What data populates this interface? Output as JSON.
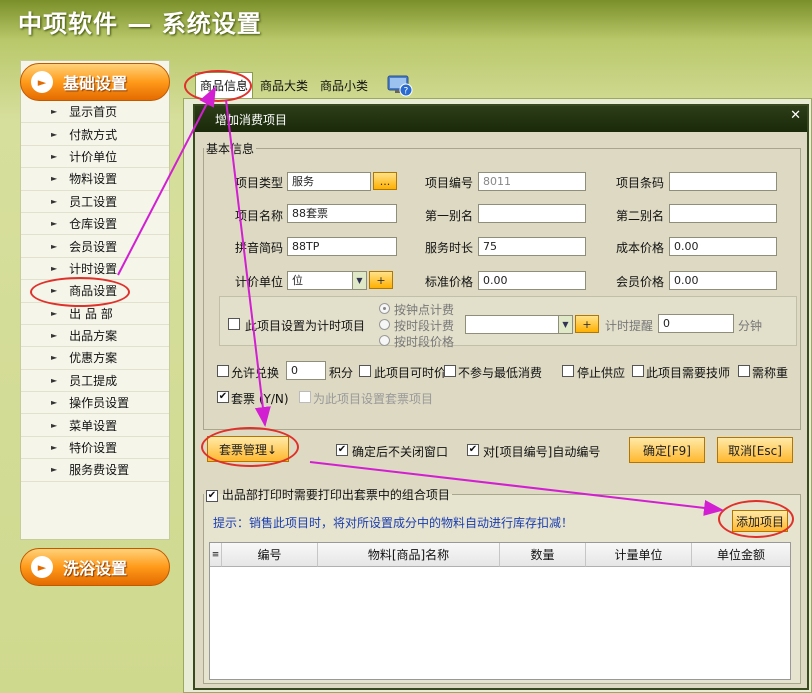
{
  "app_title": "中项软件 — 系统设置",
  "sidebar": {
    "section1": "基础设置",
    "section2": "洗浴设置",
    "items": [
      {
        "label": "显示首页"
      },
      {
        "label": "付款方式"
      },
      {
        "label": "计价单位"
      },
      {
        "label": "物料设置"
      },
      {
        "label": "员工设置"
      },
      {
        "label": "仓库设置"
      },
      {
        "label": "会员设置"
      },
      {
        "label": "计时设置"
      },
      {
        "label": "商品设置"
      },
      {
        "label": "出 品 部"
      },
      {
        "label": "出品方案"
      },
      {
        "label": "优惠方案"
      },
      {
        "label": "员工提成"
      },
      {
        "label": "操作员设置"
      },
      {
        "label": "菜单设置"
      },
      {
        "label": "特价设置"
      },
      {
        "label": "服务费设置"
      }
    ]
  },
  "tabs": [
    "商品信息",
    "商品大类",
    "商品小类"
  ],
  "dialog": {
    "title": "增加消费项目",
    "basic_legend": "基本信息",
    "labels": {
      "type": "项目类型",
      "code": "项目编号",
      "barcode": "项目条码",
      "name": "项目名称",
      "alias1": "第一别名",
      "alias2": "第二别名",
      "pinyin": "拼音简码",
      "duration": "服务时长",
      "cost": "成本价格",
      "unit": "计价单位",
      "std_price": "标准价格",
      "member_price": "会员价格"
    },
    "values": {
      "type": "服务",
      "code": "8011",
      "barcode": "",
      "name": "88套票",
      "alias1": "",
      "alias2": "",
      "pinyin": "88TP",
      "duration": "75",
      "cost": "0.00",
      "unit": "位",
      "std_price": "0.00",
      "member_price": "0.00"
    },
    "ellipsis": "...",
    "plus": "+",
    "timing": {
      "checkbox_label": "此项目设置为计时项目",
      "radio1": "按钟点计费",
      "radio2": "按时段计费",
      "radio3": "按时段价格",
      "remind_label": "计时提醒",
      "remind_value": "0",
      "minutes": "分钟"
    },
    "options": {
      "allow_exchange": "允许兑换",
      "exchange_value": "0",
      "points": "积分",
      "time_price": "此项目可时价",
      "no_min": "不参与最低消费",
      "stop_supply": "停止供应",
      "need_tech": "此项目需要技师",
      "need_weigh": "需称重",
      "package": "套票 (Y/N)",
      "package_set": "为此项目设置套票项目"
    },
    "package_mgmt": "套票管理↓",
    "keep_open": "确定后不关闭窗口",
    "auto_number": "对[项目编号]自动编号",
    "ok": "确定[F9]",
    "cancel": "取消[Esc]",
    "print_legend": "出品部打印时需要打印出套票中的组合项目",
    "tip": "提示：销售此项目时，将对所设置成分中的物料自动进行库存扣减！",
    "add_item": "添加项目",
    "columns": [
      "编号",
      "物料[商品]名称",
      "数量",
      "计量单位",
      "单位金额"
    ]
  }
}
